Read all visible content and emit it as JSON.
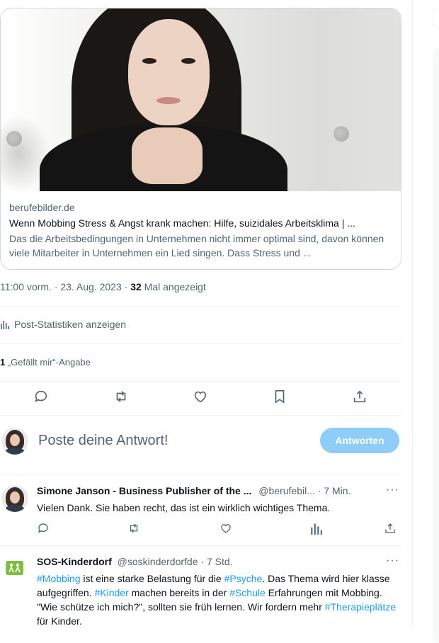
{
  "link_card": {
    "domain": "berufebilder.de",
    "title": "Wenn Mobbing Stress & Angst krank machen: Hilfe, suizidales Arbeitsklima | ...",
    "description": "Das die Arbeitsbedingungen in Unternehmen nicht immer optimal sind, davon können viele Mitarbeiter in Unternehmen ein Lied singen. Dass Stress und ..."
  },
  "post_meta": {
    "time": "11:00 vorm.",
    "sep1": " · ",
    "date": "23. Aug. 2023",
    "sep2": " · ",
    "views": "32",
    "views_label": " Mal angezeigt"
  },
  "stats_link": "Post-Statistiken anzeigen",
  "likes": {
    "count": "1",
    "label": " „Gefällt mir“-Angabe"
  },
  "actions": [
    "reply-icon",
    "repost-icon",
    "like-icon",
    "bookmark-icon",
    "share-icon"
  ],
  "reply_box": {
    "placeholder": "Poste deine Antwort!",
    "button": "Antworten"
  },
  "replies": [
    {
      "name": "Simone Janson - Business Publisher of the ...",
      "handle": "@berufebil...",
      "time": "7 Min.",
      "more": "···",
      "text": "Vielen Dank. Sie haben recht, das ist ein wirklich wichtiges Thema."
    },
    {
      "name": "SOS-Kinderdorf",
      "handle": "@soskinderdorfde",
      "time": "7 Std.",
      "more": "···",
      "segments": [
        {
          "t": "#Mobbing",
          "tag": true
        },
        {
          "t": " ist eine starke Belastung für die ",
          "tag": false
        },
        {
          "t": "#Psyche",
          "tag": true
        },
        {
          "t": ". Das Thema wird hier klasse aufgegriffen. ",
          "tag": false
        },
        {
          "t": "#Kinder",
          "tag": true
        },
        {
          "t": " machen bereits in der ",
          "tag": false
        },
        {
          "t": "#Schule",
          "tag": true
        },
        {
          "t": " Erfahrungen mit Mobbing. \"Wie schütze ich mich?\", sollten sie früh lernen. Wir fordern mehr ",
          "tag": false
        },
        {
          "t": "#Therapieplätze",
          "tag": true
        },
        {
          "t": " für Kinder.",
          "tag": false
        }
      ]
    }
  ],
  "colors": {
    "link": "#1d9bf0",
    "button": "#8ecdf8",
    "muted": "#536471",
    "sos": "#7dbe3c"
  }
}
